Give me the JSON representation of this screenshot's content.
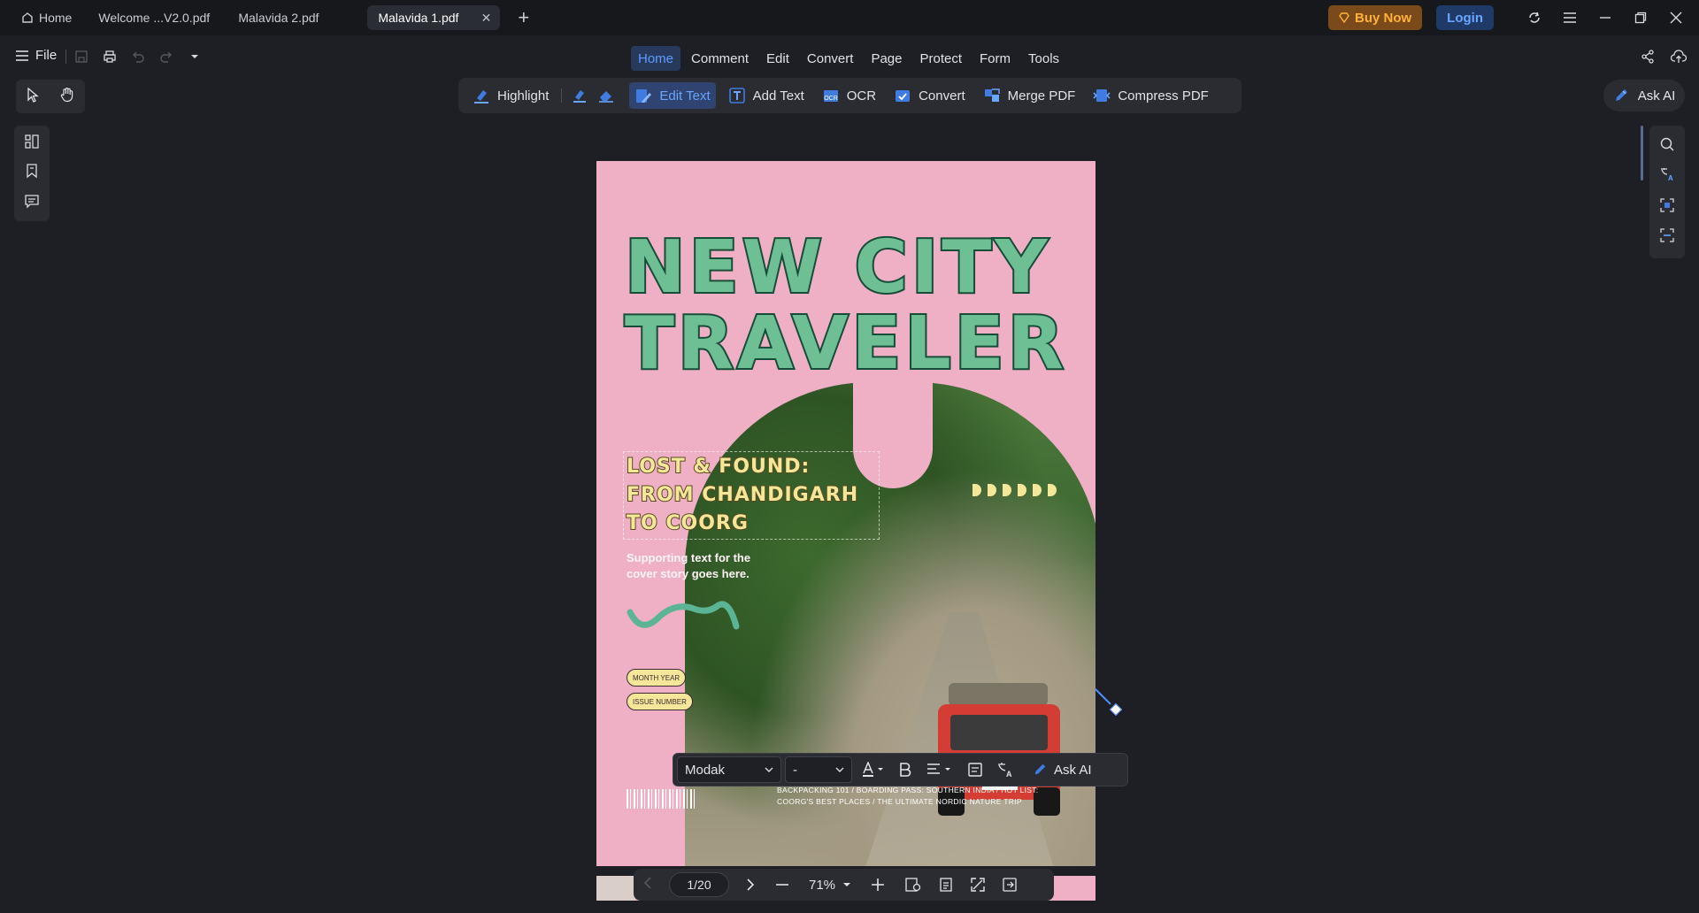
{
  "tabs": {
    "home_label": "Home",
    "items": [
      {
        "label": "Welcome ...V2.0.pdf"
      },
      {
        "label": "Malavida 2.pdf"
      },
      {
        "label": "Malavida 1.pdf"
      }
    ]
  },
  "header": {
    "buy_label": "Buy Now",
    "login_label": "Login"
  },
  "menu": {
    "file_label": "File",
    "tabs": [
      "Home",
      "Comment",
      "Edit",
      "Convert",
      "Page",
      "Protect",
      "Form",
      "Tools"
    ],
    "active_tab": "Home"
  },
  "toolbar": {
    "highlight": "Highlight",
    "edit_text": "Edit Text",
    "add_text": "Add Text",
    "ocr": "OCR",
    "convert": "Convert",
    "merge_pdf": "Merge PDF",
    "compress_pdf": "Compress PDF",
    "ask_ai": "Ask AI"
  },
  "document": {
    "title_line1": "NEW CITY",
    "title_line2": "TRAVELER",
    "story_line1": "LOST & FOUND:",
    "story_line2": "FROM CHANDIGARH",
    "story_line3": "TO COORG",
    "supporting_text": "Supporting text for the cover story goes here.",
    "pill_month": "MONTH YEAR",
    "pill_issue": "ISSUE NUMBER",
    "footer_line1": "BACKPACKING 101 / BOARDING PASS: SOUTHERN INDIA / HOT LIST:",
    "footer_line2": "COORG'S BEST PLACES / THE ULTIMATE NORDIC NATURE TRIP"
  },
  "format_bar": {
    "font": "Modak",
    "size": "-",
    "ask_ai": "Ask AI"
  },
  "navigation": {
    "page_indicator": "1/20",
    "zoom": "71%"
  },
  "colors": {
    "accent": "#5e9bff",
    "page_pink": "#efb0c6",
    "title_green": "#6fbf95",
    "story_yellow": "#f4e79a",
    "buy_orange": "#ffb13a"
  }
}
